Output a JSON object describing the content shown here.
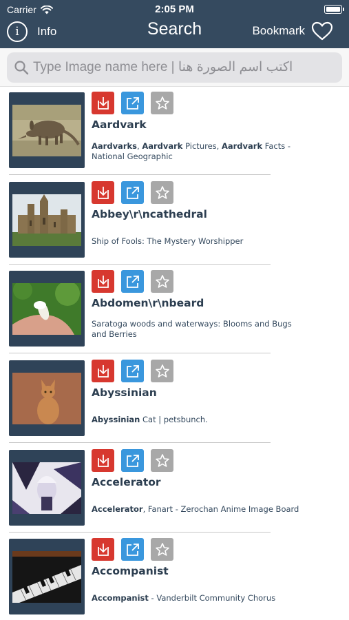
{
  "status": {
    "carrier": "Carrier",
    "time": "2:05 PM"
  },
  "nav": {
    "info_label": "Info",
    "title": "Search",
    "bookmark_label": "Bookmark"
  },
  "search": {
    "placeholder": "Type Image name here | اكتب اسم الصورة هنا"
  },
  "colors": {
    "header": "#354a5f",
    "download": "#d7382f",
    "share": "#3a97dd",
    "bookmark": "#a8a8a8"
  },
  "items": [
    {
      "name": "Aardvark",
      "desc_parts": [
        [
          "Aardvarks",
          true
        ],
        [
          ", ",
          false
        ],
        [
          "Aardvark",
          true
        ],
        [
          " Pictures, ",
          false
        ],
        [
          "Aardvark",
          true
        ],
        [
          " Facts - National Geographic",
          false
        ]
      ]
    },
    {
      "name": "Abbey\\r\\ncathedral",
      "desc_parts": [
        [
          "Ship of Fools: The Mystery Worshipper",
          false
        ]
      ]
    },
    {
      "name": "Abdomen\\r\\nbeard",
      "desc_parts": [
        [
          "Saratoga woods and waterways: Blooms and Bugs and Berries",
          false
        ]
      ]
    },
    {
      "name": "Abyssinian",
      "desc_parts": [
        [
          "Abyssinian",
          true
        ],
        [
          " Cat | petsbunch.",
          false
        ]
      ]
    },
    {
      "name": "Accelerator",
      "desc_parts": [
        [
          "Accelerator",
          true
        ],
        [
          ", Fanart - Zerochan Anime Image Board",
          false
        ]
      ]
    },
    {
      "name": "Accompanist",
      "desc_parts": [
        [
          "Accompanist",
          true
        ],
        [
          " - Vanderbilt Community Chorus",
          false
        ]
      ]
    }
  ]
}
